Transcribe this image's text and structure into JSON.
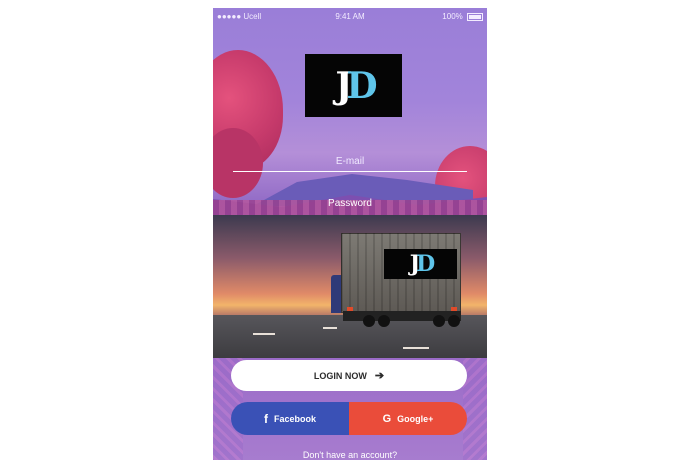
{
  "status_bar": {
    "carrier": "●●●●● Ucell",
    "time": "9:41 AM",
    "battery": "100%"
  },
  "logo": {
    "letter1": "J",
    "letter2": "D"
  },
  "form": {
    "email_label": "E-mail",
    "password_label": "Password"
  },
  "truck_logo": {
    "letter1": "J",
    "letter2": "D"
  },
  "actions": {
    "login_label": "LOGIN NOW",
    "login_icon": "arrow-right-icon",
    "facebook_label": "Facebook",
    "facebook_icon": "f",
    "google_label": "Google+",
    "google_icon": "G",
    "signup_prompt": "Don't have an account?"
  },
  "colors": {
    "facebook": "#3a51b6",
    "google": "#ea4c3a",
    "background": "#9a7ed8"
  }
}
